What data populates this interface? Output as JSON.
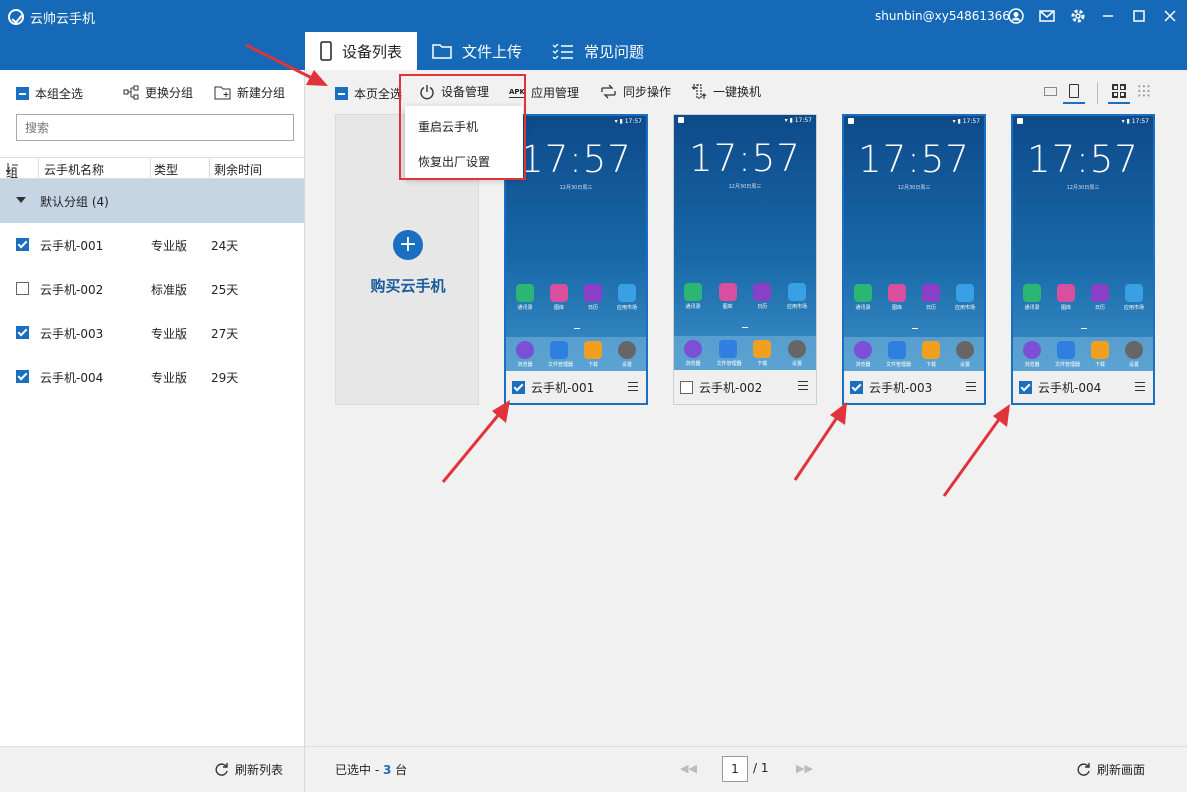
{
  "window": {
    "title": "云帅云手机",
    "account": "shunbin@xy54861366"
  },
  "tabs": [
    {
      "label": "设备列表",
      "active": true
    },
    {
      "label": "文件上传",
      "active": false
    },
    {
      "label": "常见问题",
      "active": false
    }
  ],
  "sidebar": {
    "select_all": "本组全选",
    "change_group": "更换分组",
    "new_group": "新建分组",
    "search_placeholder": "搜索",
    "columns": {
      "group": "组",
      "name": "云手机名称",
      "type": "类型",
      "remaining": "剩余时间"
    },
    "group_label": "默认分组 (4)",
    "rows": [
      {
        "name": "云手机-001",
        "type": "专业版",
        "remaining": "24天",
        "checked": true
      },
      {
        "name": "云手机-002",
        "type": "标准版",
        "remaining": "25天",
        "checked": false
      },
      {
        "name": "云手机-003",
        "type": "专业版",
        "remaining": "27天",
        "checked": true
      },
      {
        "name": "云手机-004",
        "type": "专业版",
        "remaining": "29天",
        "checked": true
      }
    ],
    "refresh_list": "刷新列表"
  },
  "toolbar": {
    "select_page": "本页全选",
    "device_manage": "设备管理",
    "app_manage": "应用管理",
    "sync_ops": "同步操作",
    "one_key_swap": "一键换机",
    "apk_badge": "APK"
  },
  "dropdown": {
    "items": [
      "重启云手机",
      "恢复出厂设置"
    ]
  },
  "buy": {
    "label": "购买云手机"
  },
  "phone_screen": {
    "time": "17:57",
    "date": "12月30日周三",
    "status_time": "17:57",
    "apps": [
      "通讯录",
      "图库",
      "日历",
      "应用市场"
    ],
    "dock": [
      "浏览器",
      "文件管理器",
      "下载",
      "设置"
    ]
  },
  "phones": [
    {
      "name": "云手机-001",
      "checked": true
    },
    {
      "name": "云手机-002",
      "checked": false
    },
    {
      "name": "云手机-003",
      "checked": true
    },
    {
      "name": "云手机-004",
      "checked": true
    }
  ],
  "footer": {
    "selected_prefix": "已选中 - ",
    "selected_count": "3",
    "selected_suffix": " 台",
    "page_current": "1",
    "page_total": "/ 1",
    "refresh_screen": "刷新画面"
  },
  "colors": {
    "brand": "#1569b6",
    "accent": "#1a6fc0",
    "highlight": "#e0343a",
    "group_bg": "#c5d5e4"
  }
}
